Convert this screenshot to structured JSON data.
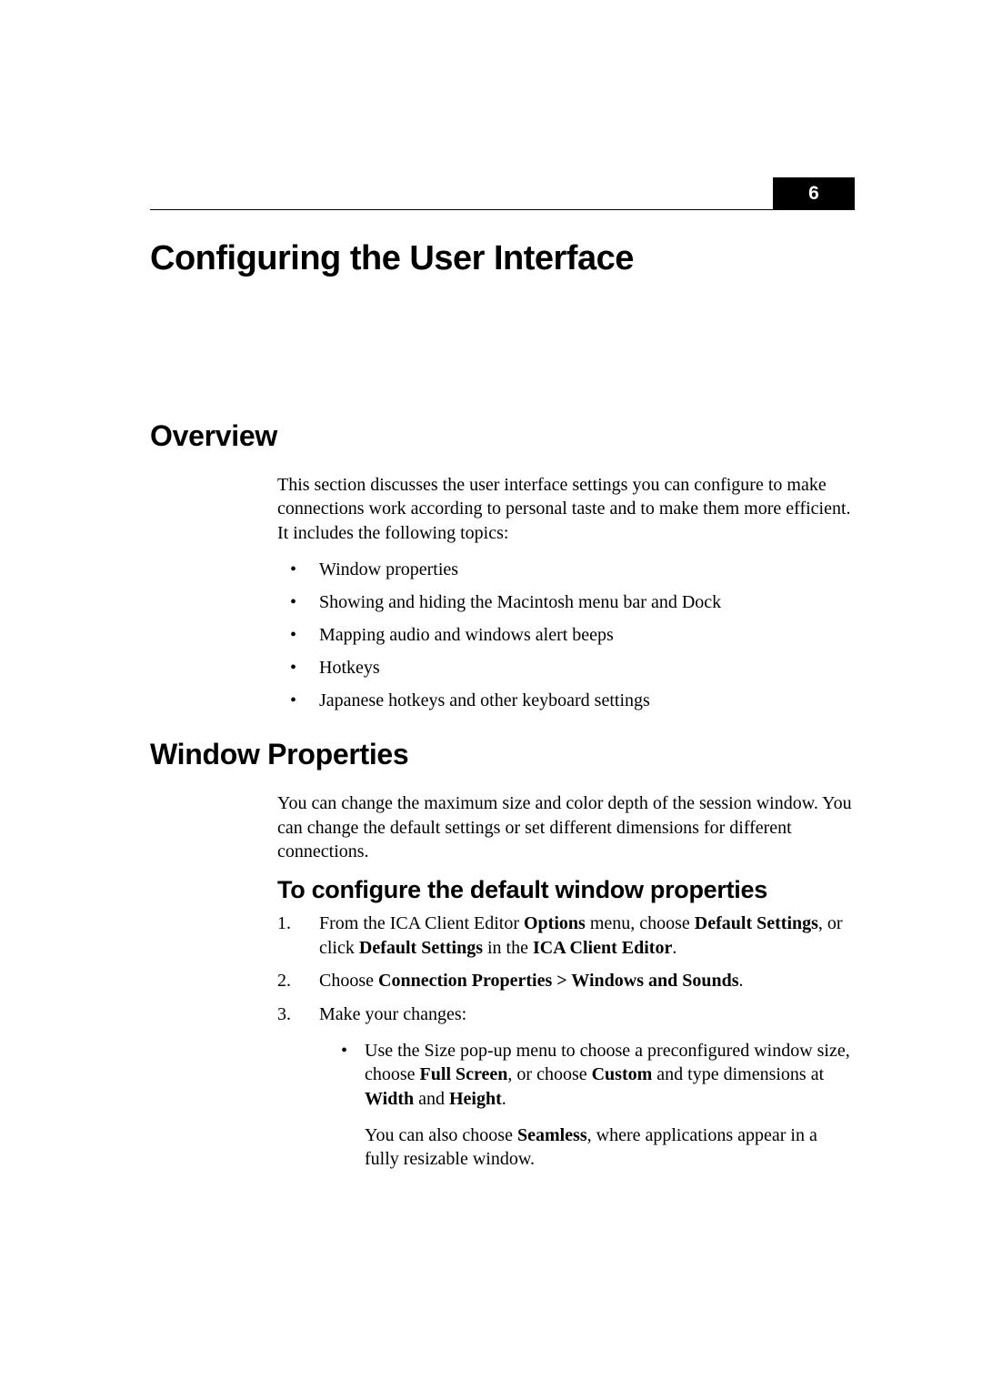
{
  "chapter": {
    "number": "6",
    "title": "Configuring the User Interface"
  },
  "overview": {
    "heading": "Overview",
    "intro": "This section discusses the user interface settings you can configure to make connections work according to personal taste and to make them more efficient. It includes the following topics:",
    "topics": [
      "Window properties",
      "Showing and hiding the Macintosh menu bar and Dock",
      "Mapping audio and windows alert beeps",
      "Hotkeys",
      "Japanese hotkeys and other keyboard settings"
    ]
  },
  "window_properties": {
    "heading": "Window Properties",
    "intro": "You can change the maximum size and color depth of the session window. You can change the default settings or set different dimensions for different connections.",
    "subheading": "To configure the default window properties",
    "steps": {
      "s1_prefix": "From the ICA Client Editor ",
      "s1_b1": "Options",
      "s1_mid1": " menu, choose ",
      "s1_b2": "Default Settings",
      "s1_mid2": ", or click ",
      "s1_b3": "Default Settings",
      "s1_mid3": " in the ",
      "s1_b4": "ICA Client Editor",
      "s1_suffix": ".",
      "s2_prefix": "Choose ",
      "s2_b1": "Connection Properties > Windows and Sounds",
      "s2_suffix": ".",
      "s3_text": "Make your changes:",
      "s3_bullet_prefix": "Use the Size pop-up menu to choose a preconfigured window size, choose ",
      "s3_b1": "Full Screen",
      "s3_mid1": ", or choose ",
      "s3_b2": "Custom",
      "s3_mid2": " and type dimensions at ",
      "s3_b3": "Width",
      "s3_mid3": " and ",
      "s3_b4": "Height",
      "s3_suffix": ".",
      "s3_follow_prefix": "You can also choose ",
      "s3_follow_b1": "Seamless",
      "s3_follow_suffix": ", where applications appear in a fully resizable window."
    }
  }
}
